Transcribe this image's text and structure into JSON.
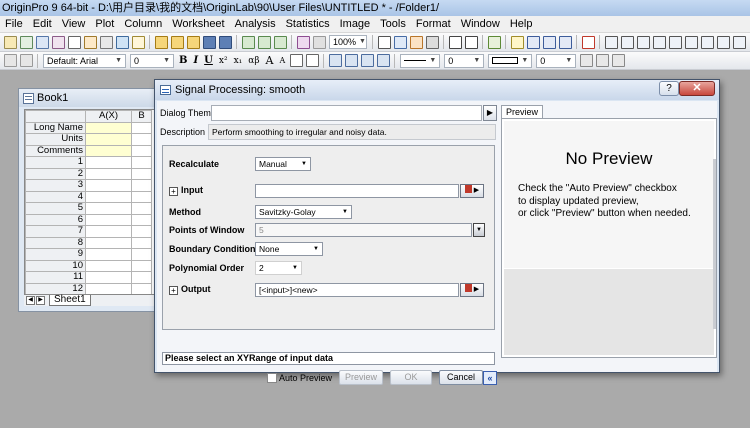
{
  "app": {
    "title": "OriginPro 9 64-bit - D:\\用户目录\\我的文档\\OriginLab\\90\\User Files\\UNTITLED * - /Folder1/"
  },
  "menu": [
    "File",
    "Edit",
    "View",
    "Plot",
    "Column",
    "Worksheet",
    "Analysis",
    "Statistics",
    "Image",
    "Tools",
    "Format",
    "Window",
    "Help"
  ],
  "toolbar": {
    "zoom": "100%",
    "font_name": "Default: Arial",
    "font_size": "0",
    "bold": "B",
    "italic": "I",
    "underline": "U",
    "superscript": "x²",
    "subscript": "x₁",
    "greek": "αβ",
    "size_a_up": "A",
    "size_a_down": "A",
    "line_width": "0",
    "pattern_size": "0"
  },
  "book": {
    "title": "Book1",
    "col_a": "A(X)",
    "col_b": "B",
    "meta_rows": [
      "Long Name",
      "Units",
      "Comments"
    ],
    "rows": [
      "1",
      "2",
      "3",
      "4",
      "5",
      "6",
      "7",
      "8",
      "9",
      "10",
      "11",
      "12"
    ],
    "sheet_tab": "Sheet1"
  },
  "dialog": {
    "title": "Signal Processing: smooth",
    "help": "?",
    "close": "✕",
    "theme_label": "Dialog Theme",
    "theme_value": "",
    "description_label": "Description",
    "description": "Perform smoothing to irregular and noisy data.",
    "recalculate_label": "Recalculate",
    "recalculate_value": "Manual",
    "input_label": "Input",
    "input_value": "",
    "method_label": "Method",
    "method_value": "Savitzky-Golay",
    "points_label": "Points of Window",
    "points_value": "5",
    "boundary_label": "Boundary Condition",
    "boundary_value": "None",
    "poly_label": "Polynomial Order",
    "poly_value": "2",
    "output_label": "Output",
    "output_value": "[<input>]<new>",
    "status": "Please select an XYRange of input data",
    "auto_preview": "Auto Preview",
    "preview_btn": "Preview",
    "ok_btn": "OK",
    "cancel_btn": "Cancel",
    "collapse": "«",
    "preview_tab": "Preview",
    "no_preview_title": "No Preview",
    "no_preview_line1": "Check the \"Auto Preview\" checkbox",
    "no_preview_line2": "to display updated preview,",
    "no_preview_line3": "or click \"Preview\" button when needed."
  }
}
